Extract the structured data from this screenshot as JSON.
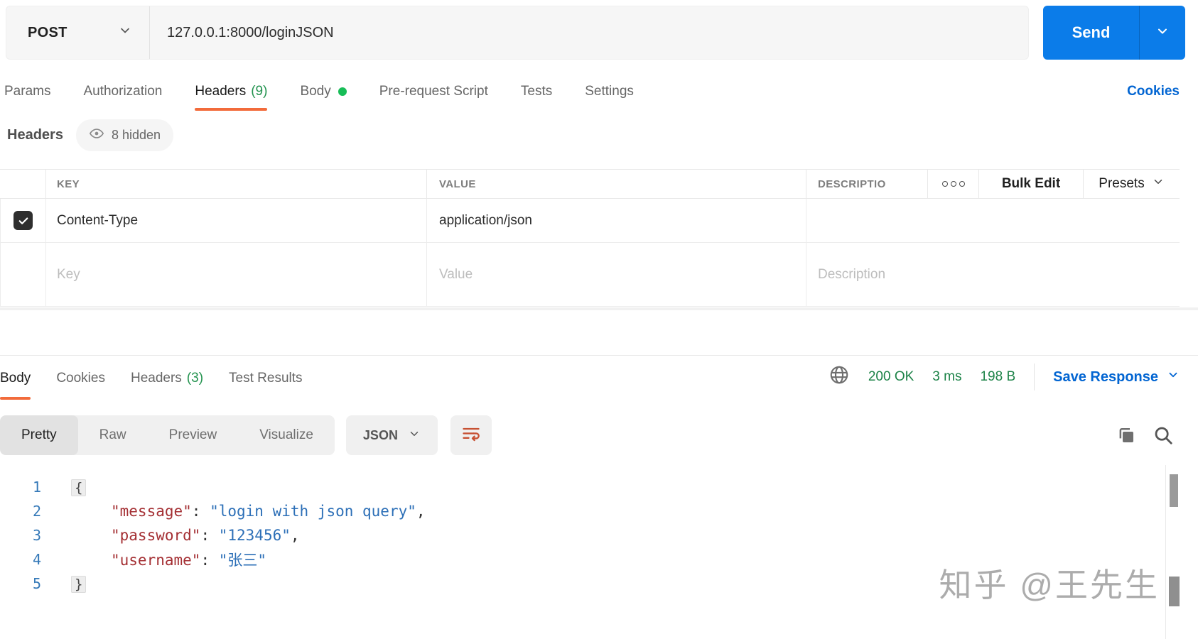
{
  "colors": {
    "accent_orange": "#F26B3B",
    "send_blue": "#0B7CE9",
    "link_blue": "#0265D2",
    "status_green": "#1D8348",
    "count_green": "#23934F",
    "body_dot_green": "#17BD57"
  },
  "request_bar": {
    "method": "POST",
    "url": "127.0.0.1:8000/loginJSON",
    "send": "Send"
  },
  "request_tabs": {
    "params": "Params",
    "authorization": "Authorization",
    "headers": "Headers",
    "headers_count": "(9)",
    "body": "Body",
    "pre_request": "Pre-request Script",
    "tests": "Tests",
    "settings": "Settings",
    "cookies": "Cookies"
  },
  "headers_panel": {
    "title": "Headers",
    "hidden": "8 hidden"
  },
  "table": {
    "col_key": "KEY",
    "col_value": "VALUE",
    "col_description": "DESCRIPTIO",
    "bulk_edit": "Bulk Edit",
    "presets": "Presets",
    "row1": {
      "key": "Content-Type",
      "value": "application/json",
      "checked": true
    },
    "row2": {
      "key_ph": "Key",
      "value_ph": "Value",
      "desc_ph": "Description"
    }
  },
  "response": {
    "tab_body": "Body",
    "tab_cookies": "Cookies",
    "tab_headers": "Headers",
    "tab_headers_count": "(3)",
    "tab_tests": "Test Results",
    "status_code": "200 OK",
    "time": "3 ms",
    "size": "198 B",
    "save": "Save Response",
    "view_pretty": "Pretty",
    "view_raw": "Raw",
    "view_preview": "Preview",
    "view_visualize": "Visualize",
    "format": "JSON"
  },
  "code": {
    "l1": {
      "num": "1",
      "brace": "{"
    },
    "l2": {
      "num": "2",
      "key": "\"message\"",
      "sep": ": ",
      "val": "\"login with json query\"",
      "comma": ","
    },
    "l3": {
      "num": "3",
      "key": "\"password\"",
      "sep": ": ",
      "val": "\"123456\"",
      "comma": ","
    },
    "l4": {
      "num": "4",
      "key": "\"username\"",
      "sep": ": ",
      "val": "\"张三\""
    },
    "l5": {
      "num": "5",
      "brace": "}"
    }
  },
  "watermark": "知乎 @王先生"
}
